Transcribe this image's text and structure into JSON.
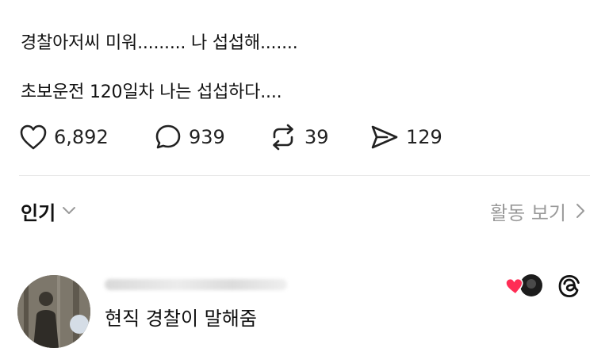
{
  "post": {
    "line1": "경찰아저씨 미워......... 나 섭섭해.......",
    "line2": "초보운전 120일차 나는 섭섭하다...."
  },
  "actions": {
    "likes": "6,892",
    "comments": "939",
    "reposts": "39",
    "shares": "129"
  },
  "sort": {
    "label": "인기",
    "activity_label": "활동 보기"
  },
  "reply": {
    "text": "현직 경찰이 말해줌"
  },
  "icons": {
    "like": "heart-outline-icon",
    "comment": "speech-bubble-icon",
    "repost": "repost-arrows-icon",
    "share": "paper-plane-icon",
    "sort_chevron": "chevron-down-icon",
    "activity_chevron": "chevron-right-icon",
    "liked_badge": "red-heart-icon",
    "app": "threads-logo-icon"
  },
  "colors": {
    "text": "#111111",
    "muted": "#9a9a9a",
    "divider": "#e6e6e6",
    "heart": "#ff2d55"
  }
}
